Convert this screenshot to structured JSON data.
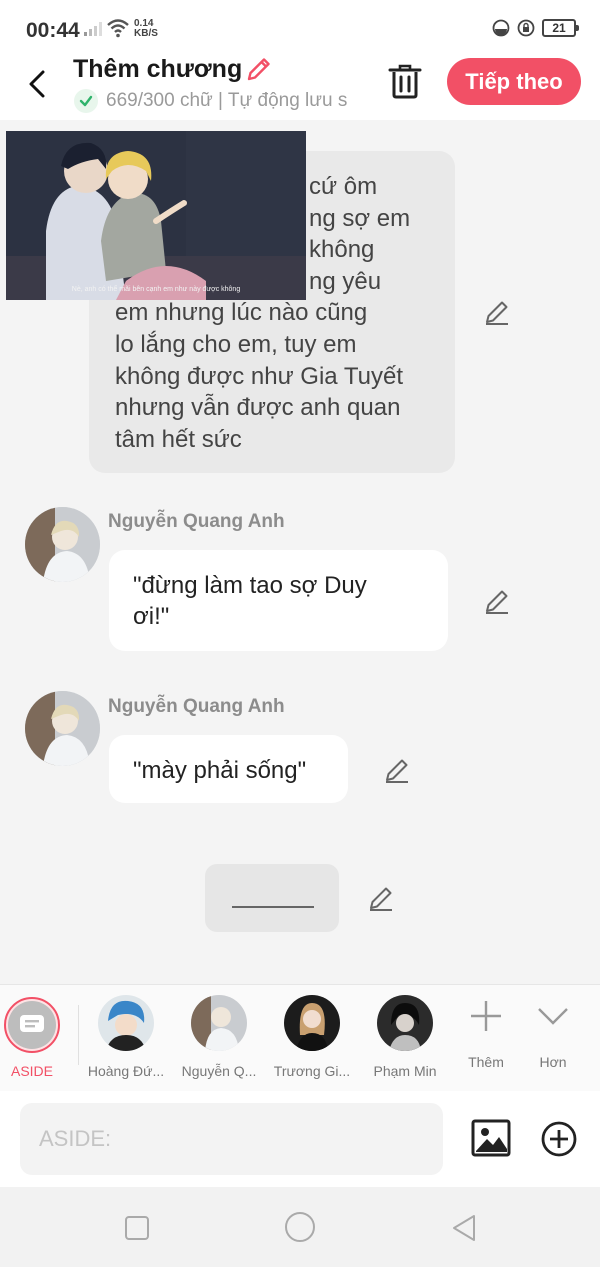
{
  "status_bar": {
    "time": "00:44",
    "speed_value": "0.14",
    "speed_unit": "KB/S",
    "battery": "21"
  },
  "header": {
    "title": "Thêm chương",
    "subtitle": "669/300 chữ | Tự động lưu s",
    "next_label": "Tiếp theo"
  },
  "video": {
    "caption": "Nè, anh có thể mãi bên cạnh em như này được không"
  },
  "messages": [
    {
      "lines": [
        "cứ ôm",
        "ng sợ em",
        "không",
        "ng yêu",
        "em nhưng lúc nào cũng",
        "lo lắng cho em, tuy em",
        "không được như Gia Tuyết",
        "nhưng vẫn được anh quan",
        "tâm hết sức"
      ]
    },
    {
      "sender": "Nguyễn Quang Anh",
      "lines": [
        "\"đừng làm tao sợ Duy",
        "ơi!\""
      ]
    },
    {
      "sender": "Nguyễn Quang Anh",
      "lines": [
        "\"mày phải sống\""
      ]
    }
  ],
  "character_bar": {
    "aside_label": "ASIDE",
    "characters": [
      {
        "name": "Hoàng Đứ...",
        "avatar_color": "#3a86c8"
      },
      {
        "name": "Nguyễn Q...",
        "avatar_color": "#a9b3bd"
      },
      {
        "name": "Trương Gi...",
        "avatar_color": "#1c1c1c"
      },
      {
        "name": "Phạm Min",
        "avatar_color": "#2b2b2b"
      }
    ],
    "add_label": "Thêm",
    "more_label": "Hơn"
  },
  "input": {
    "placeholder": "ASIDE:"
  },
  "colors": {
    "accent": "#f25066",
    "grey_bubble": "#e9e9e9",
    "check": "#2fb36b"
  }
}
